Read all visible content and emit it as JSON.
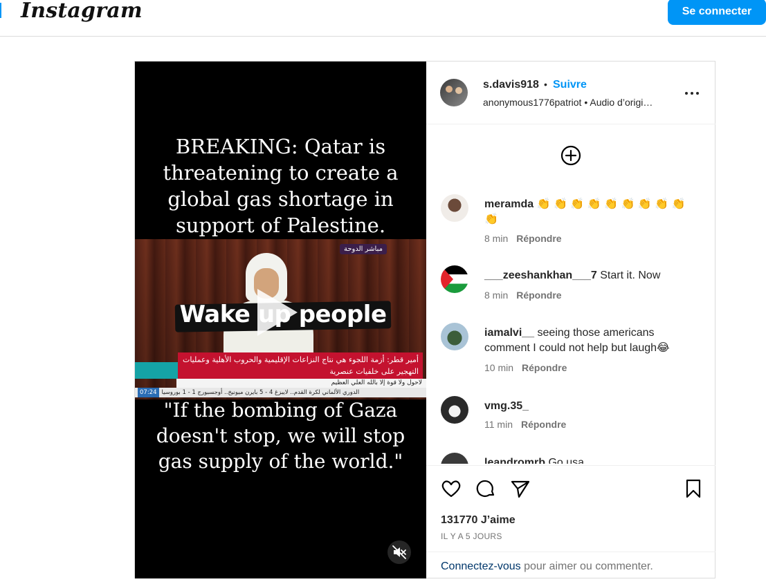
{
  "header": {
    "logo_text": "Instagram",
    "login_button": "Se connecter"
  },
  "post": {
    "author": "s.davis918",
    "follow_label": "Suivre",
    "separator": "•",
    "audio_account": "anonymous1776patriot",
    "audio_label": "Audio d’origi…",
    "media": {
      "caption_top": "BREAKING: Qatar is threatening to  create a global gas shortage in support of Palestine.",
      "caption_bottom": "\"If the bombing of Gaza doesn't stop, we will stop gas supply of the world.\"",
      "overlay_text": "Wake up people",
      "channel_badge": "مباشر الدوحة",
      "news_ticker": "أمير قطر: أزمة اللجوء هي نتاج النزاعات الإقليمية والحروب الأهلية وعمليات التهجير على خلفيات عنصرية",
      "ticker_line_2": "لاحول ولا قوة إلا بالله العلي العظيم",
      "ticker_time": "07:24",
      "ticker_line_3": "الدوري الألماني لكرة القدم.. لايبزغ 4 - 5 بايرن ميونيخ.. أوجسبورج 1 - 1 بوروسيا"
    },
    "comments": [
      {
        "user": "meramda",
        "text": "👏 👏 👏 👏 👏 👏 👏 👏 👏 👏",
        "time": "8 min",
        "reply": "Répondre",
        "avatar_icon": "user-avatar"
      },
      {
        "user": "___zeeshankhan___7",
        "text": "Start it. Now",
        "time": "8 min",
        "reply": "Répondre",
        "avatar_icon": "palestine-flag-avatar"
      },
      {
        "user": "iamalvi__",
        "text": "seeing those americans comment I could not help but laugh😂",
        "time": "10 min",
        "reply": "Répondre",
        "avatar_icon": "user-avatar"
      },
      {
        "user": "vmg.35_",
        "text": "",
        "time": "11 min",
        "reply": "Répondre",
        "avatar_icon": "user-avatar"
      },
      {
        "user": "leandromrb",
        "text": "Go usa",
        "time": "",
        "reply": "",
        "avatar_icon": "user-avatar"
      }
    ],
    "likes": "131770 J’aime",
    "date": "IL Y A 5 JOURS",
    "login_prompt": {
      "link": "Connectez-vous",
      "rest": " pour aimer ou commenter."
    }
  },
  "icons": [
    "more-options-icon",
    "add-circle-icon",
    "heart-icon",
    "comment-icon",
    "share-icon",
    "bookmark-icon",
    "mute-icon",
    "play-icon"
  ],
  "colors": {
    "accent": "#0095f6",
    "text": "#262626",
    "muted": "#737373",
    "border": "#dbdbdb"
  }
}
